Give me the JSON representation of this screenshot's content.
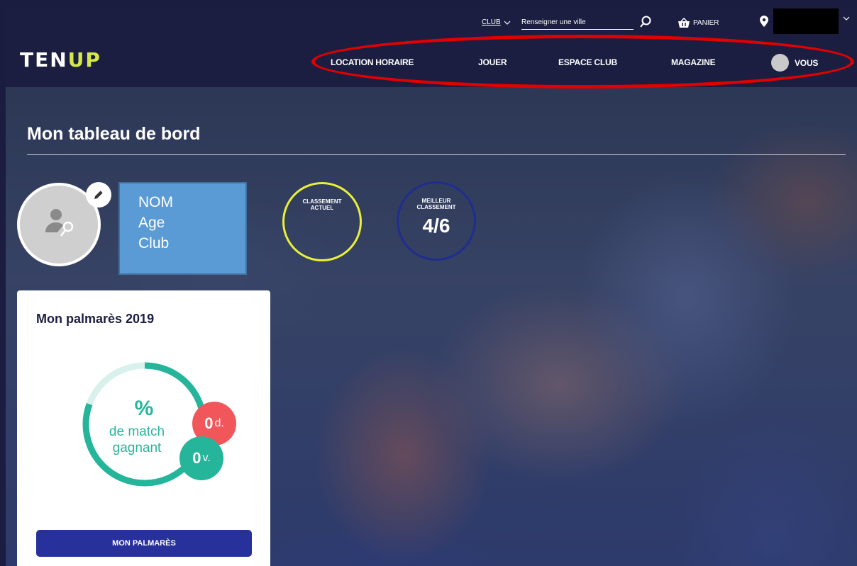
{
  "topbar": {
    "club_label": "CLUB",
    "city_placeholder": "Renseigner une ville",
    "cart_label": "PANIER"
  },
  "nav": {
    "logo_a": "TEN",
    "logo_b": "UP",
    "items": [
      "LOCATION HORAIRE",
      "JOUER",
      "ESPACE CLUB",
      "MAGAZINE"
    ],
    "vous_label": "VOUS"
  },
  "dashboard": {
    "title": "Mon tableau de bord",
    "info": {
      "name": "NOM",
      "age": "Age",
      "club": "Club"
    },
    "rank_current": {
      "label_1": "CLASSEMENT",
      "label_2": "ACTUEL",
      "value": ""
    },
    "rank_best": {
      "label_1": "MEILLEUR",
      "label_2": "CLASSEMENT",
      "value": "4/6"
    }
  },
  "palmares": {
    "title": "Mon palmarès 2019",
    "percent_symbol": "%",
    "percent_text_1": "de match",
    "percent_text_2": "gagnant",
    "defeats": "0",
    "defeats_suffix": "d.",
    "victories": "0",
    "victories_suffix": "v.",
    "button_label": "MON PALMARÈS"
  },
  "colors": {
    "navy": "#1b1e40",
    "accent_yellow": "#d4e84a",
    "teal": "#25b59a",
    "red": "#f0565a",
    "button_blue": "#28309c",
    "info_blue": "#5b9bd5",
    "highlight_red": "#e00000"
  }
}
